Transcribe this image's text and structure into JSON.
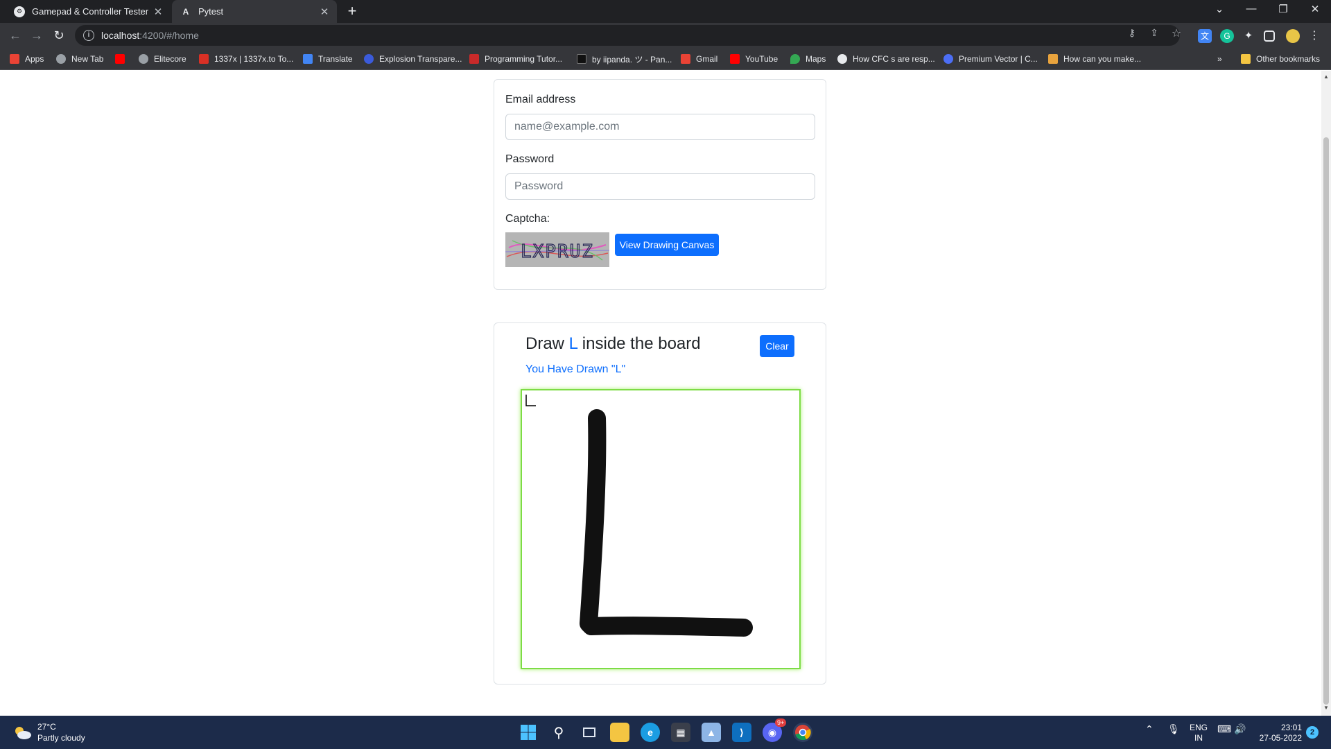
{
  "browser": {
    "tabs": [
      {
        "title": "Gamepad & Controller Tester | D",
        "icon": "gamepad-icon"
      },
      {
        "title": "Pytest",
        "icon": "angular-icon"
      }
    ],
    "address": {
      "host": "localhost",
      "path": ":4200/#/home"
    },
    "bookmarks": [
      {
        "label": "Apps",
        "color": "#ea4335"
      },
      {
        "label": "New Tab",
        "color": "#9aa0a6"
      },
      {
        "label": "Elitecore",
        "color": "#9aa0a6"
      },
      {
        "label": "1337x | 1337x.to To...",
        "color": "#d93025"
      },
      {
        "label": "Translate",
        "color": "#4285f4"
      },
      {
        "label": "Explosion Transpare...",
        "color": "#3b5bdb"
      },
      {
        "label": "Programming Tutor...",
        "color": "#c92a2a"
      },
      {
        "label": "by iipanda. ツ - Pan...",
        "color": "#111111"
      },
      {
        "label": "Gmail",
        "color": "#ea4335"
      },
      {
        "label": "YouTube",
        "color": "#ff0000"
      },
      {
        "label": "Maps",
        "color": "#34a853"
      },
      {
        "label": "How CFC s are resp...",
        "color": "#e8eaed"
      },
      {
        "label": "Premium Vector | C...",
        "color": "#4c6ef5"
      },
      {
        "label": "How can you make...",
        "color": "#e8a33d"
      }
    ],
    "other_bookmarks": "Other bookmarks"
  },
  "form": {
    "email_label": "Email address",
    "email_placeholder": "name@example.com",
    "password_label": "Password",
    "password_placeholder": "Password",
    "captcha_label": "Captcha:",
    "captcha_text": "LXPRUZ",
    "view_canvas_button": "View Drawing Canvas"
  },
  "drawing": {
    "heading_prefix": "Draw ",
    "target_letter": "L",
    "heading_suffix": " inside the board",
    "clear_button": "Clear",
    "result_message": "You Have Drawn \"L\""
  },
  "taskbar": {
    "temperature": "27°C",
    "weather": "Partly cloudy",
    "language": "ENG",
    "region": "IN",
    "time": "23:01",
    "date": "27-05-2022",
    "notifications": "2",
    "discord_badge": "9+"
  },
  "colors": {
    "primary": "#0d6efd",
    "canvas_border": "#7ddc45",
    "taskbar": "#1c2b4a"
  }
}
